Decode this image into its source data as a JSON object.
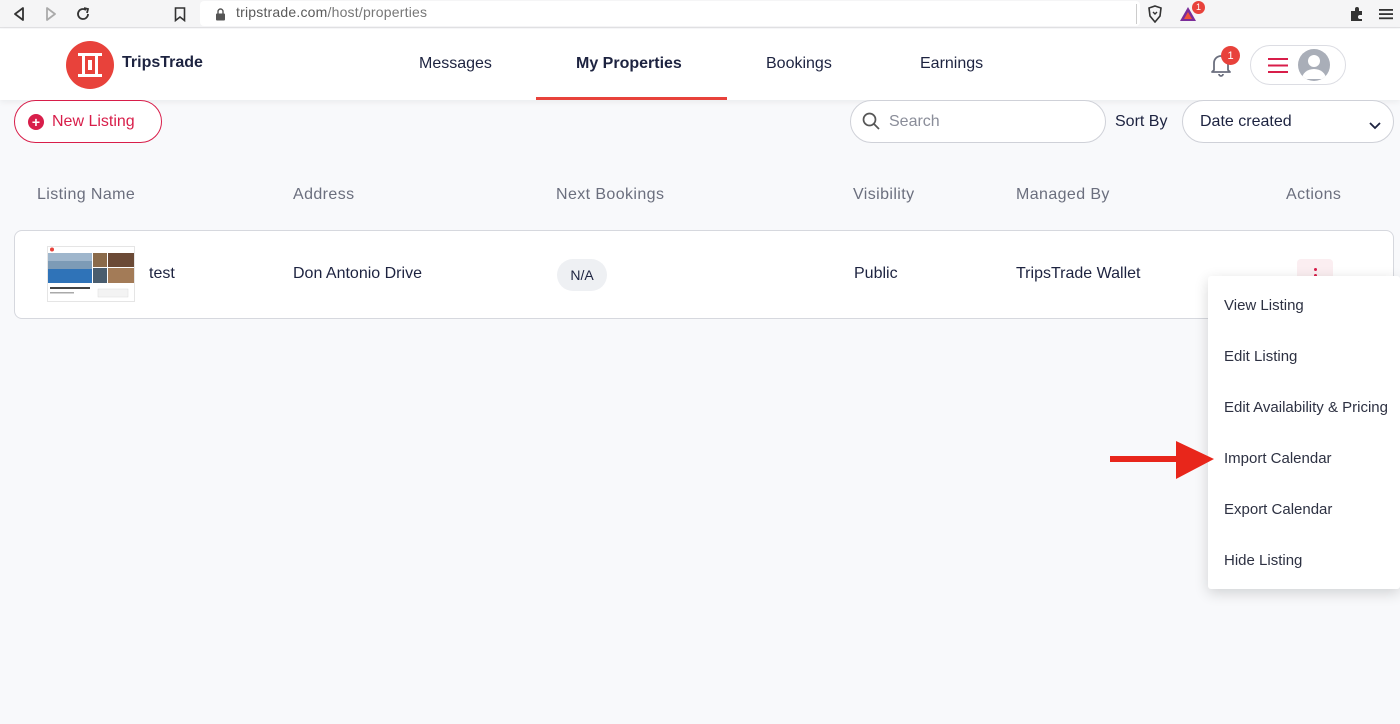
{
  "browser": {
    "url_domain": "tripstrade.com",
    "url_path": "/host/properties",
    "extension_badge": "1"
  },
  "header": {
    "brand": "TripsTrade",
    "nav": [
      "Messages",
      "My Properties",
      "Bookings",
      "Earnings"
    ],
    "active_nav": "My Properties",
    "notification_count": "1",
    "accent_color": "#e8423b"
  },
  "toolbar": {
    "new_listing_label": "New Listing",
    "search_placeholder": "Search",
    "sort_label": "Sort By",
    "sort_value": "Date created"
  },
  "table": {
    "columns": [
      "Listing Name",
      "Address",
      "Next Bookings",
      "Visibility",
      "Managed By",
      "Actions"
    ],
    "rows": [
      {
        "name": "test",
        "address": "Don Antonio Drive",
        "next_bookings": "N/A",
        "visibility": "Public",
        "managed_by": "TripsTrade Wallet"
      }
    ]
  },
  "actions_menu": {
    "items": [
      "View Listing",
      "Edit Listing",
      "Edit Availability & Pricing",
      "Import Calendar",
      "Export Calendar",
      "Hide Listing"
    ],
    "highlighted": "Import Calendar"
  }
}
